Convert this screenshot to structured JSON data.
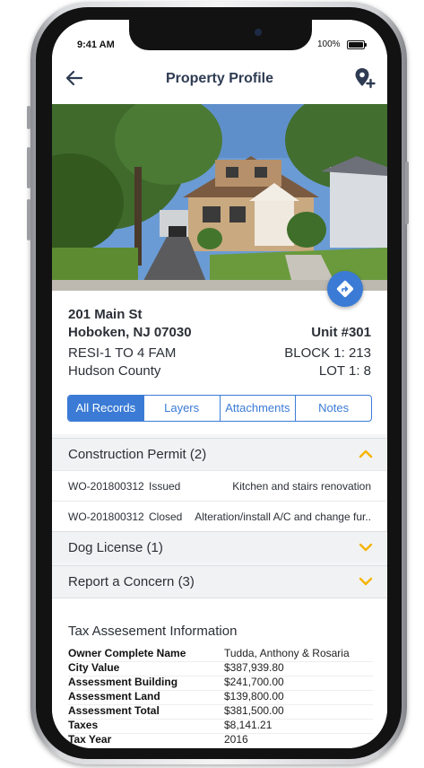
{
  "status_bar": {
    "time": "9:41 AM",
    "battery": "100%"
  },
  "header": {
    "title": "Property Profile"
  },
  "property": {
    "address_line1": "201 Main St",
    "address_line2": "Hoboken, NJ 07030",
    "unit": "Unit #301",
    "class": "RESI-1 TO 4 FAM",
    "block": "BLOCK 1: 213",
    "county": "Hudson County",
    "lot": "LOT 1: 8"
  },
  "tabs": [
    {
      "label": "All Records",
      "active": true
    },
    {
      "label": "Layers",
      "active": false
    },
    {
      "label": "Attachments",
      "active": false
    },
    {
      "label": "Notes",
      "active": false
    }
  ],
  "sections": {
    "construction": {
      "title": "Construction Permit (2)",
      "expanded": true,
      "records": [
        {
          "id": "WO-201800312",
          "status": "Issued",
          "description": "Kitchen and stairs renovation"
        },
        {
          "id": "WO-201800312",
          "status": "Closed",
          "description": "Alteration/install A/C and change fur.."
        }
      ]
    },
    "dog": {
      "title": "Dog License (1)",
      "expanded": false
    },
    "concern": {
      "title": "Report a Concern (3)",
      "expanded": false
    }
  },
  "tax": {
    "title": "Tax Assesement Information",
    "rows": [
      {
        "label": "Owner Complete Name",
        "value": "Tudda, Anthony & Rosaria"
      },
      {
        "label": "City Value",
        "value": "$387,939.80"
      },
      {
        "label": "Assessment Building",
        "value": "$241,700.00"
      },
      {
        "label": "Assessment Land",
        "value": "$139,800.00"
      },
      {
        "label": "Assessment Total",
        "value": "$381,500.00"
      },
      {
        "label": "Taxes",
        "value": "$8,141.21"
      },
      {
        "label": "Tax Year",
        "value": "2016"
      }
    ]
  },
  "colors": {
    "accent": "#3b7bd5",
    "chevron": "#f5b400",
    "title": "#2e3b52"
  },
  "icons": {
    "back": "arrow-left-icon",
    "add_location": "add-location-icon",
    "directions": "directions-icon",
    "chevron": "chevron-icon"
  }
}
